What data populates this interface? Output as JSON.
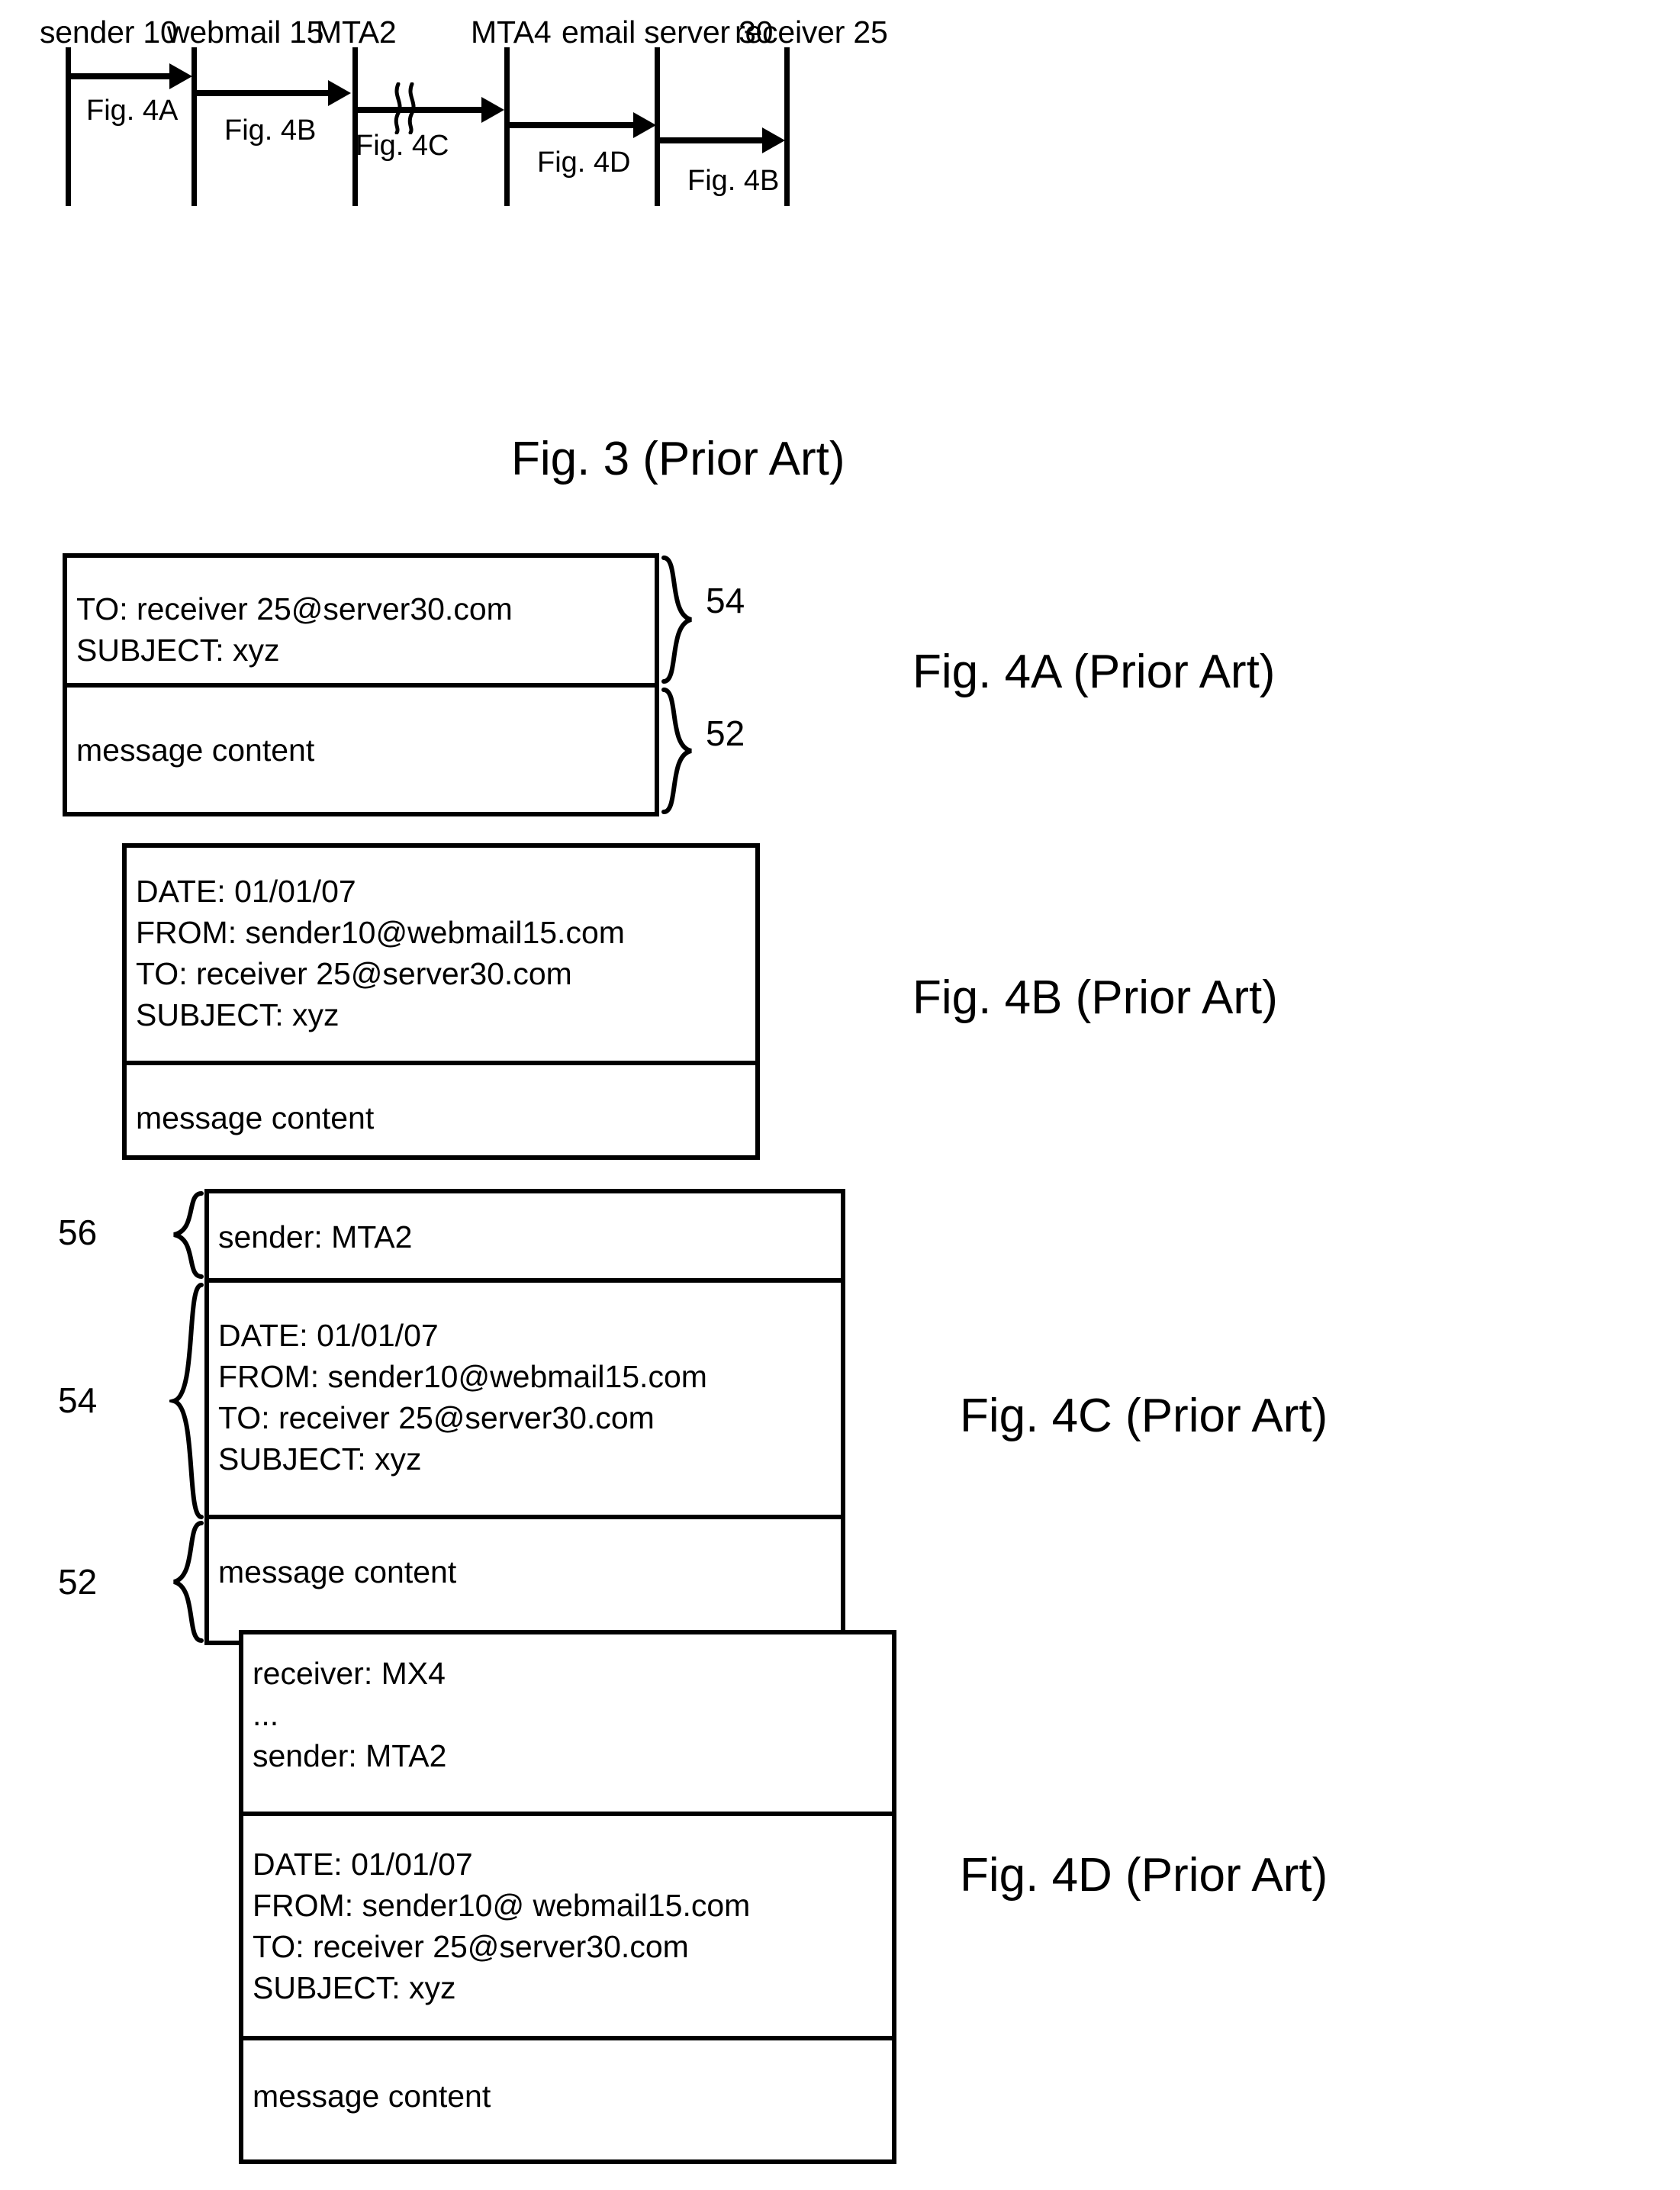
{
  "figure3": {
    "caption": "Fig. 3 (Prior Art)",
    "lifelines": [
      {
        "label": "sender 10"
      },
      {
        "label": "webmail 15"
      },
      {
        "label": "MTA2"
      },
      {
        "label": "MTA4"
      },
      {
        "label": "email server 30"
      },
      {
        "label": "receiver 25"
      }
    ],
    "messages": [
      {
        "label": "Fig. 4A",
        "from": "sender 10",
        "to": "webmail 15"
      },
      {
        "label": "Fig. 4B",
        "from": "webmail 15",
        "to": "MTA2"
      },
      {
        "label": "Fig. 4C",
        "from": "MTA2",
        "to": "MTA4"
      },
      {
        "label": "Fig. 4D",
        "from": "MTA4",
        "to": "email server 30"
      },
      {
        "label": "Fig. 4B",
        "from": "email server 30",
        "to": "receiver 25"
      }
    ]
  },
  "figure4a": {
    "caption": "Fig. 4A (Prior Art)",
    "header": {
      "brace_label": "54",
      "lines": [
        "TO: receiver 25@server30.com",
        "SUBJECT: xyz"
      ]
    },
    "body": {
      "brace_label": "52",
      "lines": [
        "message content"
      ]
    }
  },
  "figure4b": {
    "caption": "Fig. 4B (Prior Art)",
    "header": {
      "lines": [
        "DATE: 01/01/07",
        "FROM: sender10@webmail15.com",
        "TO: receiver 25@server30.com",
        "SUBJECT: xyz"
      ]
    },
    "body": {
      "lines": [
        "message content"
      ]
    }
  },
  "figure4c": {
    "caption": "Fig. 4C (Prior Art)",
    "envelope": {
      "brace_label": "56",
      "lines": [
        "sender: MTA2"
      ]
    },
    "header": {
      "brace_label": "54",
      "lines": [
        "DATE: 01/01/07",
        "FROM: sender10@webmail15.com",
        "TO: receiver 25@server30.com",
        "SUBJECT: xyz"
      ]
    },
    "body": {
      "brace_label": "52",
      "lines": [
        "message content"
      ]
    }
  },
  "figure4d": {
    "caption": "Fig. 4D (Prior Art)",
    "envelope": {
      "lines": [
        "receiver: MX4",
        "...",
        "sender: MTA2"
      ]
    },
    "header": {
      "lines": [
        "DATE: 01/01/07",
        "FROM: sender10@ webmail15.com",
        "TO: receiver 25@server30.com",
        "SUBJECT: xyz"
      ]
    },
    "body": {
      "lines": [
        "message content"
      ]
    }
  }
}
